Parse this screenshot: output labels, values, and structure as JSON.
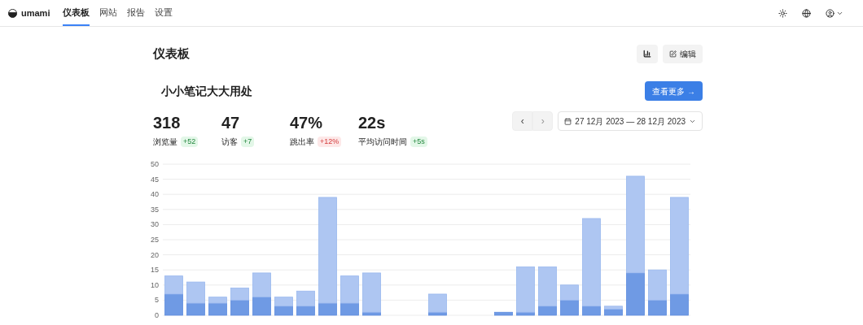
{
  "app": {
    "name": "umami"
  },
  "nav": [
    {
      "label": "仪表板",
      "selected": true
    },
    {
      "label": "网站",
      "selected": false
    },
    {
      "label": "报告",
      "selected": false
    },
    {
      "label": "设置",
      "selected": false
    }
  ],
  "page": {
    "title": "仪表板",
    "edit_button": "编辑"
  },
  "website": {
    "name": "小小笔记大大用处",
    "more_button": "查看更多 →"
  },
  "metrics": [
    {
      "value": "318",
      "label": "浏览量",
      "change": "+52",
      "positive": true
    },
    {
      "value": "47",
      "label": "访客",
      "change": "+7",
      "positive": true
    },
    {
      "value": "47%",
      "label": "跳出率",
      "change": "+12%",
      "positive": false
    },
    {
      "value": "22s",
      "label": "平均访问时间",
      "change": "+5s",
      "positive": true
    }
  ],
  "date_range": {
    "label": "27 12月 2023 — 28 12月 2023",
    "prev_label": "‹",
    "next_label": "›",
    "next_disabled": true
  },
  "chart_data": {
    "type": "bar",
    "stacked": true,
    "grid": true,
    "ylim": [
      0,
      50
    ],
    "yticks": [
      0,
      5,
      10,
      15,
      20,
      25,
      30,
      35,
      40,
      45,
      50
    ],
    "series": [
      {
        "color": "#6f9ae4",
        "values": [
          7,
          4,
          4,
          5,
          6,
          3,
          3,
          4,
          4,
          1,
          0,
          0,
          1,
          0,
          0,
          1,
          1,
          3,
          5,
          3,
          2,
          14,
          5,
          7
        ]
      },
      {
        "color": "#aec6f2",
        "values": [
          6,
          7,
          2,
          4,
          8,
          3,
          5,
          35,
          9,
          13,
          0,
          0,
          6,
          0,
          0,
          0,
          15,
          13,
          5,
          29,
          1,
          32,
          10,
          32
        ]
      }
    ]
  }
}
